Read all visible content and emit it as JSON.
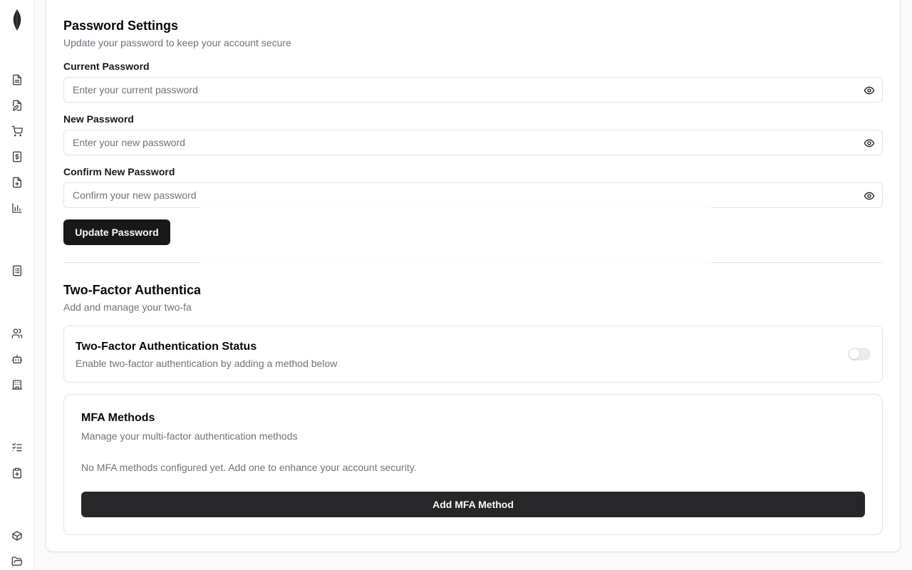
{
  "sidebar": {
    "logo_icon": "leaf-logo-icon",
    "items": [
      {
        "icon": "document-icon"
      },
      {
        "icon": "file-edit-icon"
      },
      {
        "icon": "cart-icon"
      },
      {
        "icon": "dollar-document-icon"
      },
      {
        "icon": "file-plus-icon"
      },
      {
        "icon": "bar-chart-icon"
      },
      {
        "icon": "report-document-icon"
      },
      {
        "icon": "users-icon"
      },
      {
        "icon": "bot-icon"
      },
      {
        "icon": "building-icon"
      },
      {
        "icon": "checklist-icon"
      },
      {
        "icon": "clipboard-plus-icon"
      },
      {
        "icon": "package-icon"
      },
      {
        "icon": "folder-open-icon"
      }
    ]
  },
  "password": {
    "title": "Password Settings",
    "subtitle": "Update your password to keep your account secure",
    "current_label": "Current Password",
    "current_placeholder": "Enter your current password",
    "new_label": "New Password",
    "new_placeholder": "Enter your new password",
    "confirm_label": "Confirm New Password",
    "confirm_placeholder": "Confirm your new password",
    "update_button": "Update Password"
  },
  "two_factor": {
    "title": "Two-Factor Authentica",
    "subtitle": "Add and manage your two-fa",
    "status_title": "Two-Factor Authentication Status",
    "status_desc": "Enable two-factor authentication by adding a method below",
    "status_enabled": false
  },
  "mfa": {
    "title": "MFA Methods",
    "subtitle": "Manage your multi-factor authentication methods",
    "empty_text": "No MFA methods configured yet. Add one to enhance your account security.",
    "add_button": "Add MFA Method"
  },
  "colors": {
    "primary": "#18181b",
    "muted_text": "#71717a",
    "border": "#e4e4e7"
  }
}
